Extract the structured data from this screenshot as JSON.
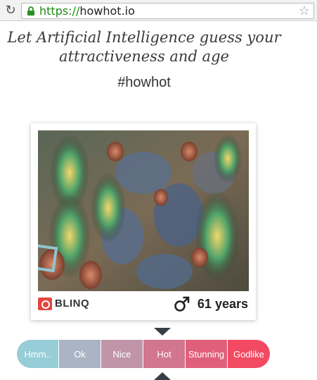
{
  "browser": {
    "url_scheme": "https://",
    "url_host": "howhot.io",
    "reload_glyph": "C",
    "star_glyph": "☆"
  },
  "page": {
    "headline_line1": "Let Artificial Intelligence guess your",
    "headline_line2": "attractiveness and age",
    "hashtag": "#howhot"
  },
  "card": {
    "brand": "BLINQ",
    "gender_icon": "male-icon",
    "age": "61 years"
  },
  "rating": {
    "options": [
      "Hmm..",
      "Ok",
      "Nice",
      "Hot",
      "Stunning",
      "Godlike"
    ],
    "selected": "Hot",
    "colors": [
      "#96cdd7",
      "#aab4c4",
      "#c195a8",
      "#d2758f",
      "#e0607b",
      "#f24a63"
    ]
  }
}
